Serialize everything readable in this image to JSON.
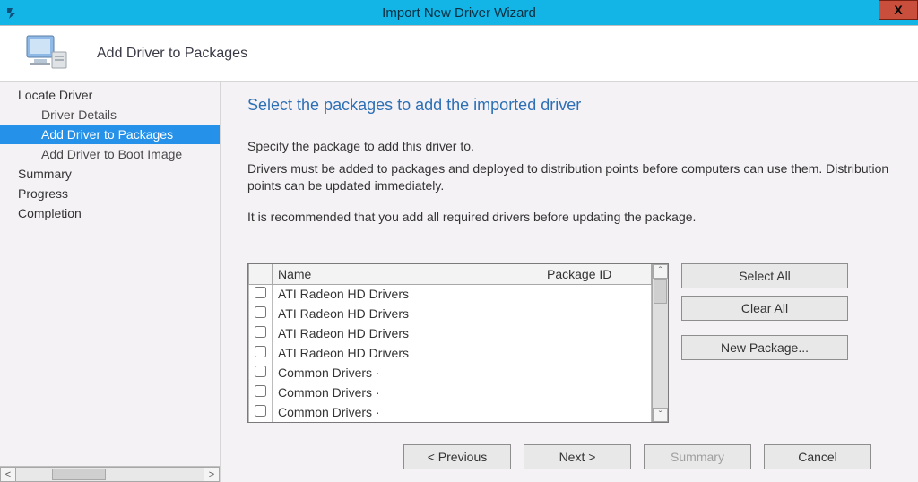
{
  "window": {
    "title": "Import New Driver Wizard",
    "close_symbol": "X"
  },
  "banner": {
    "title": "Add Driver to Packages"
  },
  "nav": {
    "items": [
      {
        "label": "Locate Driver",
        "level": "top"
      },
      {
        "label": "Driver Details",
        "level": "child"
      },
      {
        "label": "Add Driver to Packages",
        "level": "child",
        "selected": true
      },
      {
        "label": "Add Driver to Boot Image",
        "level": "child"
      },
      {
        "label": "Summary",
        "level": "top"
      },
      {
        "label": "Progress",
        "level": "top"
      },
      {
        "label": "Completion",
        "level": "top"
      }
    ],
    "scroll_left": "<",
    "scroll_right": ">"
  },
  "content": {
    "heading": "Select the packages to add the imported driver",
    "instr1": "Specify the package to add this driver to.",
    "instr2": "Drivers must be added to packages and deployed to distribution points before computers can use them.  Distribution points can be updated immediately.",
    "instr3": "It is recommended that you add all required drivers before updating the package."
  },
  "table": {
    "columns": {
      "name": "Name",
      "package_id": "Package ID"
    },
    "rows": [
      {
        "name": "ATI Radeon HD Drivers",
        "package_id": ""
      },
      {
        "name": "ATI Radeon HD Drivers",
        "package_id": ""
      },
      {
        "name": "ATI Radeon HD Drivers",
        "package_id": ""
      },
      {
        "name": "ATI Radeon HD Drivers",
        "package_id": ""
      },
      {
        "name": "Common Drivers ·",
        "package_id": ""
      },
      {
        "name": "Common Drivers ·",
        "package_id": ""
      },
      {
        "name": "Common Drivers ·",
        "package_id": ""
      }
    ],
    "scroll_up": "ˆ",
    "scroll_down": "ˇ"
  },
  "sidebuttons": {
    "select_all": "Select All",
    "clear_all": "Clear All",
    "new_package": "New Package..."
  },
  "footer": {
    "previous": "< Previous",
    "next": "Next >",
    "summary": "Summary",
    "cancel": "Cancel"
  }
}
